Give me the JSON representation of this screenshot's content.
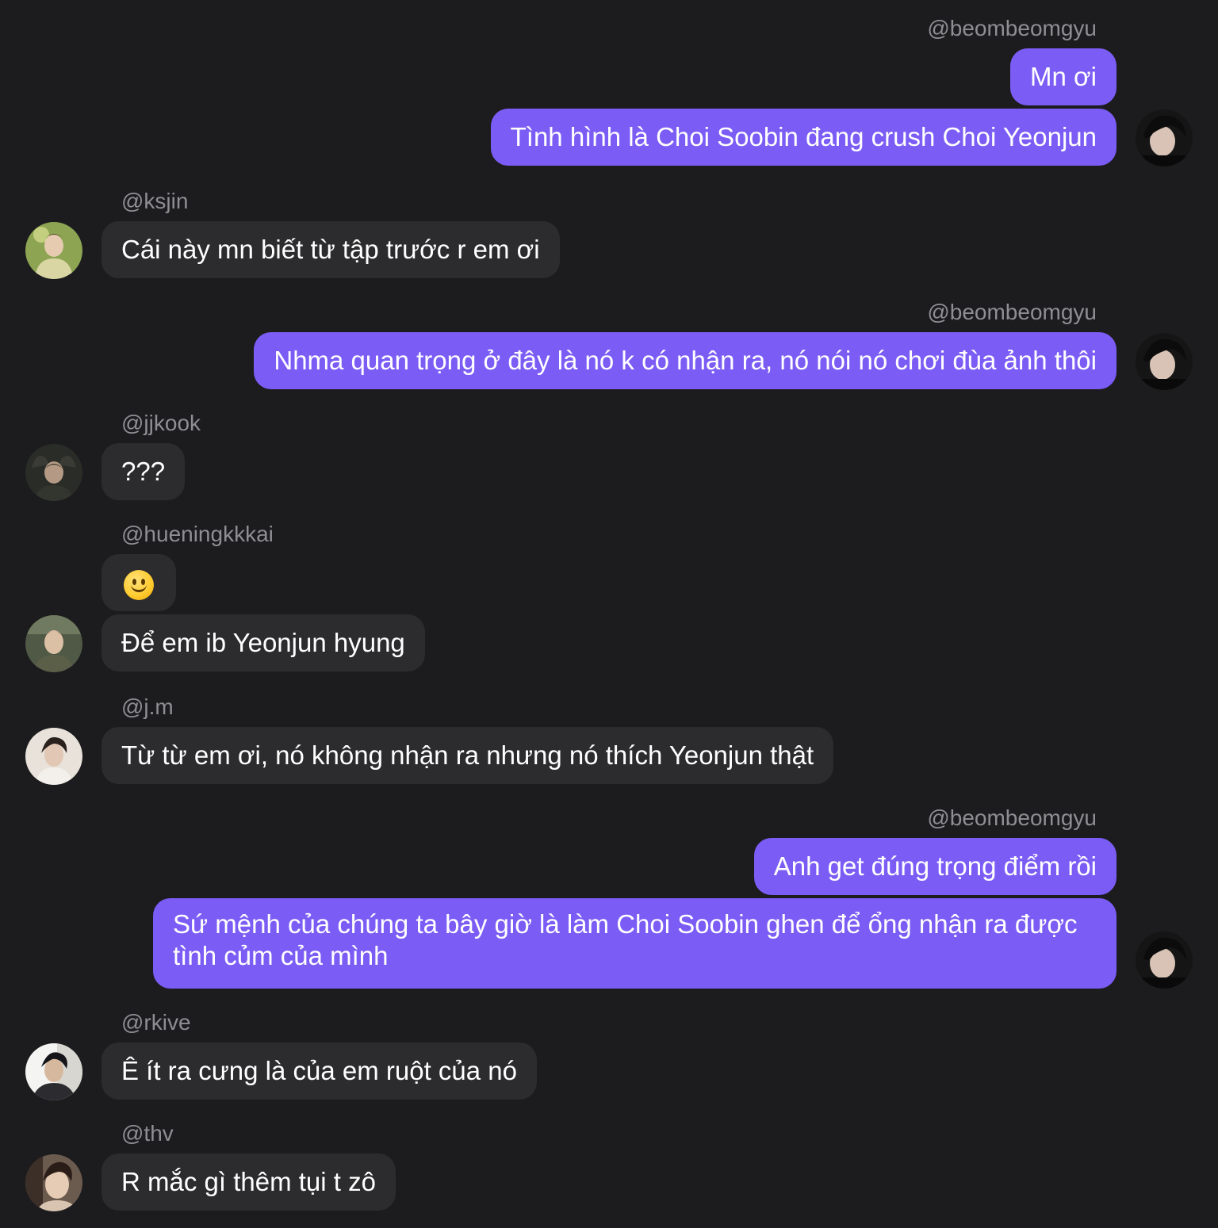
{
  "messages": [
    {
      "user": "@beombeomgyu",
      "side": "right",
      "bubbles": [
        "Mn ơi",
        "Tình hình là Choi Soobin đang crush Choi Yeonjun"
      ]
    },
    {
      "user": "@ksjin",
      "side": "left",
      "bubbles": [
        "Cái này mn biết từ tập trước r em ơi"
      ]
    },
    {
      "user": "@beombeomgyu",
      "side": "right",
      "bubbles": [
        "Nhma quan trọng ở đây là nó k có nhận ra, nó nói nó chơi đùa ảnh thôi"
      ]
    },
    {
      "user": "@jjkook",
      "side": "left",
      "bubbles": [
        "???"
      ]
    },
    {
      "user": "@hueningkkkai",
      "side": "left",
      "bubbles": [
        "slightly-smiling-face-emoji",
        "Để em ib Yeonjun hyung"
      ]
    },
    {
      "user": "@j.m",
      "side": "left",
      "bubbles": [
        "Từ từ em ơi, nó không nhận ra nhưng nó thích Yeonjun thật"
      ]
    },
    {
      "user": "@beombeomgyu",
      "side": "right",
      "bubbles": [
        "Anh get đúng trọng điểm rồi",
        "Sứ mệnh của chúng ta bây giờ là làm Choi Soobin ghen để ổng nhận ra được tình củm của mình"
      ]
    },
    {
      "user": "@rkive",
      "side": "left",
      "bubbles": [
        "Ê ít ra cưng là của em ruột của nó"
      ]
    },
    {
      "user": "@thv",
      "side": "left",
      "bubbles": [
        "R mắc gì thêm tụi t zô"
      ]
    }
  ],
  "colors": {
    "background": "#1c1c1e",
    "outgoing_bubble": "#7b5cf5",
    "incoming_bubble": "#2c2c2e",
    "username": "#8e8e93",
    "text": "#ffffff"
  }
}
